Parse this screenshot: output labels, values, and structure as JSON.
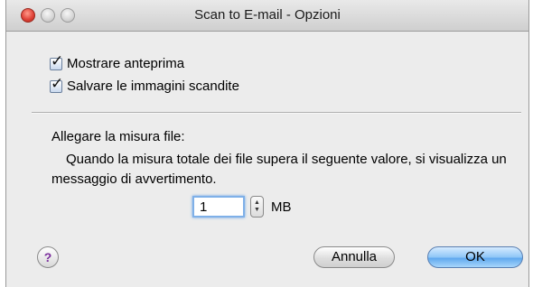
{
  "window": {
    "title": "Scan to E-mail - Opzioni"
  },
  "options": [
    {
      "label": "Mostrare anteprima",
      "checked": true
    },
    {
      "label": "Salvare le immagini scandite",
      "checked": true
    }
  ],
  "attachment": {
    "heading": "Allegare la misura file:",
    "description": "Quando la misura totale dei file supera il seguente valore, si visualizza un messaggio di avvertimento.",
    "size_value": "1",
    "unit": "MB"
  },
  "buttons": {
    "help": "?",
    "cancel": "Annulla",
    "ok": "OK"
  },
  "icons": {
    "help": "help-icon",
    "checkmark": "checkmark-icon",
    "stepper": "stepper-icon"
  },
  "colors": {
    "ok_accent": "#5fa8ee",
    "close_button": "#e0443a",
    "focus_ring": "#7fb0e8"
  }
}
